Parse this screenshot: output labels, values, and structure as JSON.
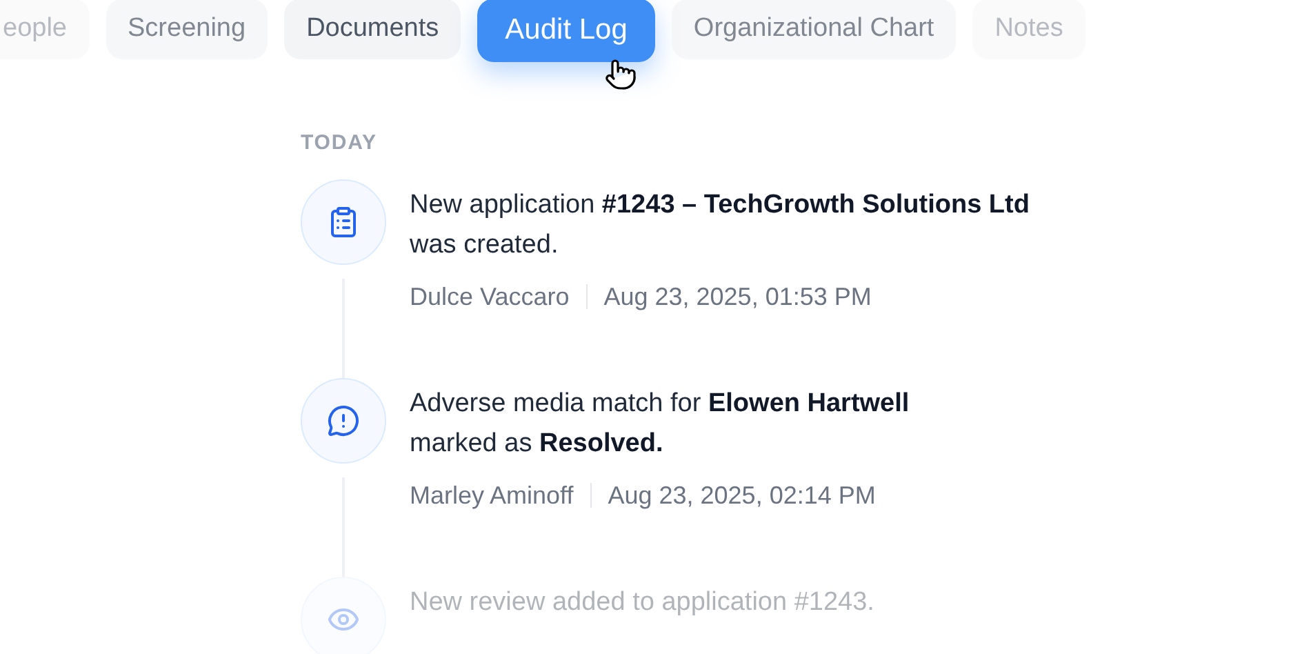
{
  "tabs": [
    {
      "label": "eople",
      "selected": false
    },
    {
      "label": "Screening",
      "selected": false
    },
    {
      "label": "Documents",
      "selected": false
    },
    {
      "label": "Audit Log",
      "selected": true
    },
    {
      "label": "Organizational Chart",
      "selected": false
    },
    {
      "label": "Notes",
      "selected": false
    }
  ],
  "section": "TODAY",
  "entries": [
    {
      "kind": "clipboard",
      "lines": [
        "New application **#1243 – TechGrowth Solutions Ltd**",
        "was created."
      ],
      "user": "Dulce Vaccaro",
      "time": "Aug 23, 2025, 01:53 PM"
    },
    {
      "kind": "alert",
      "lines": [
        "Adverse media match for **Elowen Hartwell**",
        "marked as **Resolved.**"
      ],
      "user": "Marley Aminoff",
      "time": "Aug 23, 2025, 02:14 PM"
    },
    {
      "kind": "view",
      "lines": [
        "New review added to application #1243."
      ]
    }
  ]
}
